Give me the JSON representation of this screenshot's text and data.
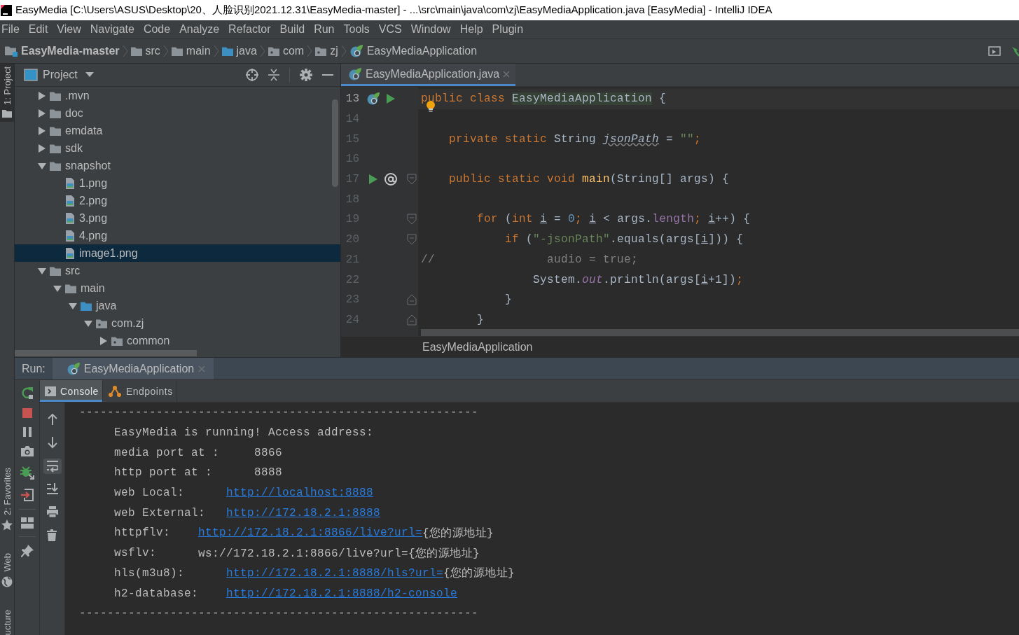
{
  "window": {
    "title": "EasyMedia [C:\\Users\\ASUS\\Desktop\\20、人脸识别2021.12.31\\EasyMedia-master] - ...\\src\\main\\java\\com\\zj\\EasyMediaApplication.java [EasyMedia] - IntelliJ IDEA"
  },
  "menu": [
    "File",
    "Edit",
    "View",
    "Navigate",
    "Code",
    "Analyze",
    "Refactor",
    "Build",
    "Run",
    "Tools",
    "VCS",
    "Window",
    "Help",
    "Plugin"
  ],
  "breadcrumbs": [
    {
      "label": "EasyMedia-master",
      "kind": "project"
    },
    {
      "label": "src",
      "kind": "folder"
    },
    {
      "label": "main",
      "kind": "folder"
    },
    {
      "label": "java",
      "kind": "source-root"
    },
    {
      "label": "com",
      "kind": "package"
    },
    {
      "label": "zj",
      "kind": "package"
    },
    {
      "label": "EasyMediaApplication",
      "kind": "class"
    }
  ],
  "tool_strip": [
    {
      "label": "1: Project",
      "kind": "project",
      "selected": true
    },
    {
      "label": "2: Favorites",
      "kind": "favorites",
      "selected": false
    },
    {
      "label": "Web",
      "kind": "web",
      "selected": false
    },
    {
      "label": "ucture",
      "kind": "structure",
      "selected": false
    }
  ],
  "project": {
    "title": "Project",
    "tree": [
      {
        "label": ".mvn",
        "kind": "folder",
        "expanded": false,
        "selected": false
      },
      {
        "label": "doc",
        "kind": "folder",
        "expanded": false,
        "selected": false
      },
      {
        "label": "emdata",
        "kind": "folder",
        "expanded": false,
        "selected": false
      },
      {
        "label": "sdk",
        "kind": "folder",
        "expanded": false,
        "selected": false
      },
      {
        "label": "snapshot",
        "kind": "folder",
        "expanded": true,
        "selected": false,
        "children": [
          {
            "label": "1.png",
            "kind": "image",
            "selected": false
          },
          {
            "label": "2.png",
            "kind": "image",
            "selected": false
          },
          {
            "label": "3.png",
            "kind": "image",
            "selected": false
          },
          {
            "label": "4.png",
            "kind": "image",
            "selected": false
          },
          {
            "label": "image1.png",
            "kind": "image",
            "selected": true
          }
        ]
      },
      {
        "label": "src",
        "kind": "folder",
        "expanded": true,
        "selected": false,
        "children": [
          {
            "label": "main",
            "kind": "folder",
            "expanded": true,
            "selected": false,
            "children": [
              {
                "label": "java",
                "kind": "source-root",
                "expanded": true,
                "selected": false,
                "children": [
                  {
                    "label": "com.zj",
                    "kind": "package",
                    "expanded": true,
                    "selected": false,
                    "children": [
                      {
                        "label": "common",
                        "kind": "package",
                        "expanded": false,
                        "selected": false
                      }
                    ]
                  }
                ]
              }
            ]
          }
        ]
      }
    ]
  },
  "editor": {
    "tabs": [
      {
        "label": "EasyMediaApplication.java",
        "selected": true
      }
    ],
    "lines": [
      {
        "number": "13",
        "current": true,
        "markers": [
          {
            "kind": "spring-class"
          },
          {
            "kind": "run"
          }
        ],
        "tokens": [
          {
            "kind": "keyword",
            "text": "public class "
          },
          {
            "kind": "highlight",
            "text": "EasyMediaApplication"
          },
          {
            "kind": "plain",
            "text": " {"
          }
        ]
      },
      {
        "number": "14",
        "current": false,
        "bulb": true
      },
      {
        "number": "15",
        "current": false,
        "tokens": [
          {
            "kind": "keyword",
            "text": "    private static "
          },
          {
            "kind": "plain",
            "text": "String "
          },
          {
            "kind": "unused",
            "text": "jsonPath"
          },
          {
            "kind": "plain",
            "text": " = "
          },
          {
            "kind": "string",
            "text": "\"\""
          },
          {
            "kind": "keyword",
            "text": ";"
          }
        ]
      },
      {
        "number": "16",
        "current": false
      },
      {
        "number": "17",
        "current": false,
        "markers": [
          {
            "kind": "run"
          },
          {
            "kind": "at"
          }
        ],
        "fold": {
          "kind": "start"
        },
        "tokens": [
          {
            "kind": "keyword",
            "text": "    public static void "
          },
          {
            "kind": "declaration",
            "text": "main"
          },
          {
            "kind": "plain",
            "text": "(String[] args) {"
          }
        ]
      },
      {
        "number": "18",
        "current": false
      },
      {
        "number": "19",
        "current": false,
        "fold": {
          "kind": "start"
        },
        "tokens": [
          {
            "kind": "keyword",
            "text": "        for "
          },
          {
            "kind": "plain",
            "text": "("
          },
          {
            "kind": "keyword",
            "text": "int "
          },
          {
            "kind": "variable",
            "text": "i"
          },
          {
            "kind": "plain",
            "text": " = "
          },
          {
            "kind": "number",
            "text": "0"
          },
          {
            "kind": "keyword",
            "text": "; "
          },
          {
            "kind": "variable",
            "text": "i"
          },
          {
            "kind": "plain",
            "text": " < args."
          },
          {
            "kind": "field",
            "text": "length"
          },
          {
            "kind": "keyword",
            "text": "; "
          },
          {
            "kind": "variable",
            "text": "i"
          },
          {
            "kind": "plain",
            "text": "++) {"
          }
        ]
      },
      {
        "number": "20",
        "current": false,
        "fold": {
          "kind": "start"
        },
        "tokens": [
          {
            "kind": "keyword",
            "text": "            if "
          },
          {
            "kind": "plain",
            "text": "("
          },
          {
            "kind": "string",
            "text": "\"-jsonPath\""
          },
          {
            "kind": "plain",
            "text": ".equals(args["
          },
          {
            "kind": "variable",
            "text": "i"
          },
          {
            "kind": "plain",
            "text": "])) {"
          }
        ]
      },
      {
        "number": "21",
        "current": false,
        "tokens": [
          {
            "kind": "comment",
            "text": "//                audio = true;"
          }
        ]
      },
      {
        "number": "22",
        "current": false,
        "tokens": [
          {
            "kind": "plain",
            "text": "                System."
          },
          {
            "kind": "static",
            "text": "out"
          },
          {
            "kind": "plain",
            "text": ".println(args["
          },
          {
            "kind": "variable",
            "text": "i"
          },
          {
            "kind": "plain",
            "text": "+1])"
          },
          {
            "kind": "keyword",
            "text": ";"
          }
        ]
      },
      {
        "number": "23",
        "current": false,
        "fold": {
          "kind": "end"
        },
        "tokens": [
          {
            "kind": "plain",
            "text": "            }"
          }
        ]
      },
      {
        "number": "24",
        "current": false,
        "fold": {
          "kind": "end"
        },
        "tokens": [
          {
            "kind": "plain",
            "text": "        }"
          }
        ]
      }
    ],
    "footer": "EasyMediaApplication"
  },
  "run": {
    "label": "Run:",
    "tabs": [
      {
        "label": "EasyMediaApplication",
        "selected": true
      }
    ],
    "subtabs": [
      {
        "label": "Console",
        "kind": "console",
        "selected": true
      },
      {
        "label": "Endpoints",
        "kind": "endpoints",
        "selected": false
      }
    ],
    "soft_wrap_on": true,
    "console": [
      {
        "kind": "separator",
        "text": "---------------------------------------------------------"
      },
      {
        "kind": "entry",
        "label": "EasyMedia is running! Access address:"
      },
      {
        "kind": "entry",
        "label": "media port at :     ",
        "value": "8866"
      },
      {
        "kind": "entry",
        "label": "http port at :      ",
        "value": "8888"
      },
      {
        "kind": "entry",
        "label": "web Local:      ",
        "link": "http://localhost:8888"
      },
      {
        "kind": "entry",
        "label": "web External:   ",
        "link": "http://172.18.2.1:8888"
      },
      {
        "kind": "entry",
        "label": "httpflv:    ",
        "link": "http://172.18.2.1:8866/live?url=",
        "suffix": "{您的源地址}"
      },
      {
        "kind": "entry",
        "label": "wsflv:      ",
        "value": "ws://172.18.2.1:8866/live?url={您的源地址}"
      },
      {
        "kind": "entry",
        "label": "hls(m3u8):      ",
        "link": "http://172.18.2.1:8888/hls?url=",
        "suffix": "{您的源地址}"
      },
      {
        "kind": "entry",
        "label": "h2-database:    ",
        "link": "http://172.18.2.1:8888/h2-console"
      },
      {
        "kind": "separator",
        "text": "---------------------------------------------------------"
      }
    ]
  }
}
